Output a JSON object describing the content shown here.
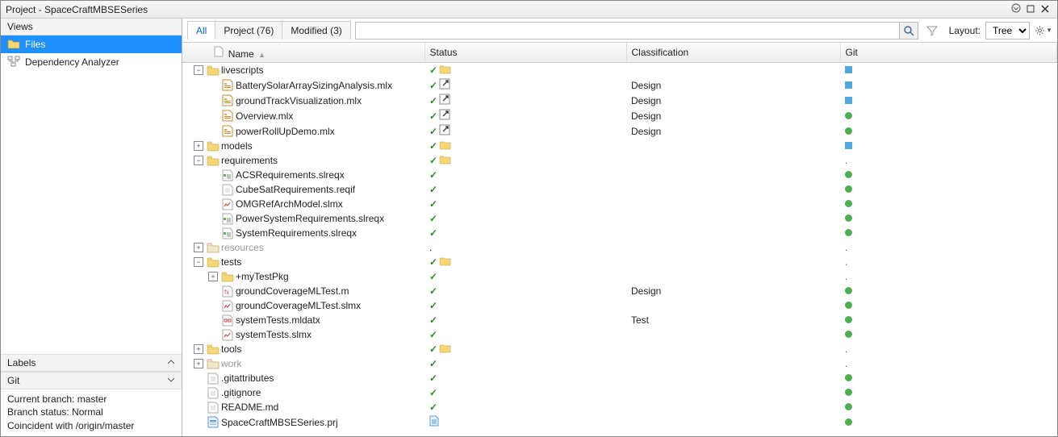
{
  "window": {
    "title": "Project - SpaceCraftMBSESeries"
  },
  "left": {
    "views_header": "Views",
    "views": [
      {
        "label": "Files",
        "icon": "folder-open",
        "selected": true
      },
      {
        "label": "Dependency Analyzer",
        "icon": "dep-analyzer",
        "selected": false
      }
    ],
    "labels_header": "Labels",
    "git_header": "Git",
    "git_lines": [
      "Current branch: master",
      "Branch status: Normal",
      "Coincident with /origin/master"
    ]
  },
  "toolbar": {
    "tabs": [
      {
        "label": "All",
        "active": true
      },
      {
        "label": "Project (76)",
        "active": false
      },
      {
        "label": "Modified (3)",
        "active": false
      }
    ],
    "search_placeholder": "",
    "layout_label": "Layout:",
    "layout_value": "Tree"
  },
  "columns": {
    "name": "Name",
    "status": "Status",
    "classification": "Classification",
    "git": "Git"
  },
  "rows": [
    {
      "name": "livescripts",
      "depth": 0,
      "toggle": "-",
      "icon": "folder",
      "faded": false,
      "status": "check-folder",
      "classification": "",
      "git": "square"
    },
    {
      "name": "BatterySolarArraySizingAnalysis.mlx",
      "depth": 1,
      "toggle": "",
      "icon": "mlx",
      "faded": false,
      "status": "check-link",
      "classification": "Design",
      "git": "square"
    },
    {
      "name": "groundTrackVisualization.mlx",
      "depth": 1,
      "toggle": "",
      "icon": "mlx",
      "faded": false,
      "status": "check-link",
      "classification": "Design",
      "git": "square"
    },
    {
      "name": "Overview.mlx",
      "depth": 1,
      "toggle": "",
      "icon": "mlx",
      "faded": false,
      "status": "check-link",
      "classification": "Design",
      "git": "dot"
    },
    {
      "name": "powerRollUpDemo.mlx",
      "depth": 1,
      "toggle": "",
      "icon": "mlx",
      "faded": false,
      "status": "check-link",
      "classification": "Design",
      "git": "dot"
    },
    {
      "name": "models",
      "depth": 0,
      "toggle": "+",
      "icon": "folder",
      "faded": false,
      "status": "check-folder",
      "classification": "",
      "git": "square"
    },
    {
      "name": "requirements",
      "depth": 0,
      "toggle": "-",
      "icon": "folder",
      "faded": false,
      "status": "check-folder",
      "classification": "",
      "git": "."
    },
    {
      "name": "ACSRequirements.slreqx",
      "depth": 1,
      "toggle": "",
      "icon": "slreqx",
      "faded": false,
      "status": "check",
      "classification": "",
      "git": "dot"
    },
    {
      "name": "CubeSatRequirements.reqif",
      "depth": 1,
      "toggle": "",
      "icon": "file",
      "faded": false,
      "status": "check",
      "classification": "",
      "git": "dot"
    },
    {
      "name": "OMGRefArchModel.slmx",
      "depth": 1,
      "toggle": "",
      "icon": "slmx",
      "faded": false,
      "status": "check",
      "classification": "",
      "git": "dot"
    },
    {
      "name": "PowerSystemRequirements.slreqx",
      "depth": 1,
      "toggle": "",
      "icon": "slreqx",
      "faded": false,
      "status": "check",
      "classification": "",
      "git": "dot"
    },
    {
      "name": "SystemRequirements.slreqx",
      "depth": 1,
      "toggle": "",
      "icon": "slreqx",
      "faded": false,
      "status": "check",
      "classification": "",
      "git": "dot"
    },
    {
      "name": "resources",
      "depth": 0,
      "toggle": "+",
      "icon": "folder",
      "faded": true,
      "status": ".",
      "classification": "",
      "git": "."
    },
    {
      "name": "tests",
      "depth": 0,
      "toggle": "-",
      "icon": "folder",
      "faded": false,
      "status": "check-folder",
      "classification": "",
      "git": "."
    },
    {
      "name": "+myTestPkg",
      "depth": 1,
      "toggle": "+",
      "icon": "folder",
      "faded": false,
      "status": "check",
      "classification": "",
      "git": "."
    },
    {
      "name": "groundCoverageMLTest.m",
      "depth": 1,
      "toggle": "",
      "icon": "m",
      "faded": false,
      "status": "check",
      "classification": "Design",
      "git": "dot"
    },
    {
      "name": "groundCoverageMLTest.slmx",
      "depth": 1,
      "toggle": "",
      "icon": "slmx",
      "faded": false,
      "status": "check",
      "classification": "",
      "git": "dot"
    },
    {
      "name": "systemTests.mldatx",
      "depth": 1,
      "toggle": "",
      "icon": "mldatx",
      "faded": false,
      "status": "check",
      "classification": "Test",
      "git": "dot"
    },
    {
      "name": "systemTests.slmx",
      "depth": 1,
      "toggle": "",
      "icon": "slmx",
      "faded": false,
      "status": "check",
      "classification": "",
      "git": "dot"
    },
    {
      "name": "tools",
      "depth": 0,
      "toggle": "+",
      "icon": "folder",
      "faded": false,
      "status": "check-folder",
      "classification": "",
      "git": "."
    },
    {
      "name": "work",
      "depth": 0,
      "toggle": "+",
      "icon": "folder",
      "faded": true,
      "status": "check",
      "classification": "",
      "git": "."
    },
    {
      "name": ".gitattributes",
      "depth": 0,
      "toggle": "",
      "icon": "file",
      "faded": false,
      "status": "check",
      "classification": "",
      "git": "dot"
    },
    {
      "name": ".gitignore",
      "depth": 0,
      "toggle": "",
      "icon": "file",
      "faded": false,
      "status": "check",
      "classification": "",
      "git": "dot"
    },
    {
      "name": "README.md",
      "depth": 0,
      "toggle": "",
      "icon": "file",
      "faded": false,
      "status": "check",
      "classification": "",
      "git": "dot"
    },
    {
      "name": "SpaceCraftMBSESeries.prj",
      "depth": 0,
      "toggle": "",
      "icon": "prj",
      "faded": false,
      "status": "doc",
      "classification": "",
      "git": "dot"
    }
  ]
}
